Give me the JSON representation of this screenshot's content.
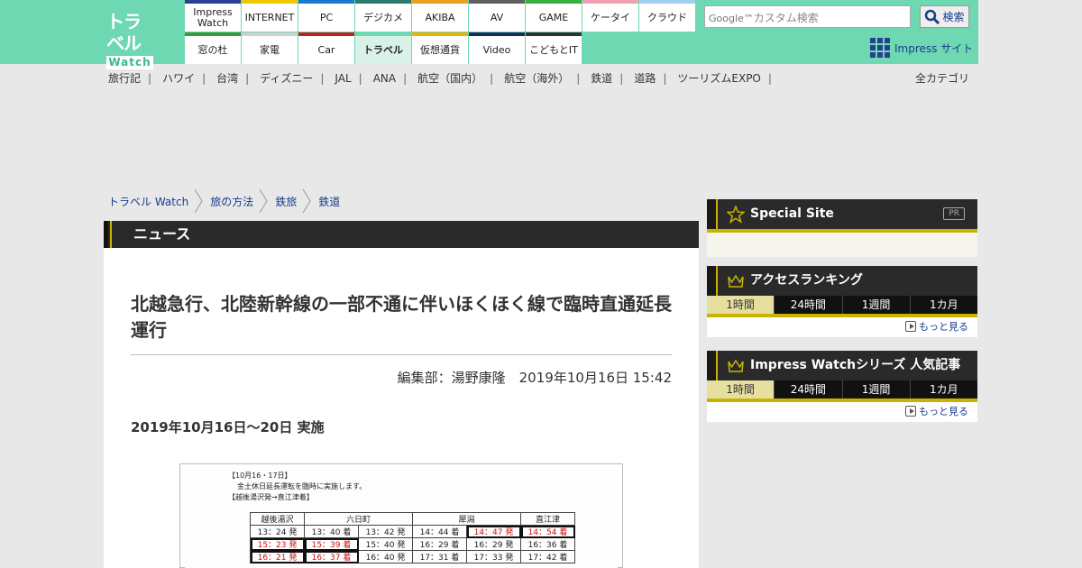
{
  "logo": {
    "top": "トラベル",
    "bottom": "Watch"
  },
  "nav_row1": [
    {
      "label": "Impress Watch",
      "color": "#2a3f90"
    },
    {
      "label": "INTERNET",
      "color": "#f0c800"
    },
    {
      "label": "PC",
      "color": "#1a7acc"
    },
    {
      "label": "デジカメ",
      "color": "#2a7a70"
    },
    {
      "label": "AKIBA",
      "color": "#e6a020"
    },
    {
      "label": "AV",
      "color": "#606060"
    },
    {
      "label": "GAME",
      "color": "#3ab040"
    },
    {
      "label": "ケータイ",
      "color": "#f0a0b0"
    },
    {
      "label": "クラウド",
      "color": "#a0d0f0"
    }
  ],
  "nav_row2": [
    {
      "label": "窓の杜",
      "color": "#3a9a3a"
    },
    {
      "label": "家電",
      "color": "#d0d0d0"
    },
    {
      "label": "Car",
      "color": "#c02020"
    },
    {
      "label": "トラベル",
      "color": "#6dd8b2"
    },
    {
      "label": "仮想通貨",
      "color": "#f0b000"
    },
    {
      "label": "Video",
      "color": "#1a2a60"
    },
    {
      "label": "こどもとIT",
      "color": "#303030"
    }
  ],
  "search": {
    "placeholder": "カスタム検索",
    "google": "Google™",
    "button": "検索"
  },
  "impress_site": "Impress サイト",
  "subnav": [
    "旅行記",
    "ハワイ",
    "台湾",
    "ディズニー",
    "JAL",
    "ANA",
    "航空（国内）",
    "航空（海外）",
    "鉄道",
    "道路",
    "ツーリズムEXPO"
  ],
  "all_categories": "全カテゴリ",
  "breadcrumb": [
    "トラベル Watch",
    "旅の方法",
    "鉄旅",
    "鉄道"
  ],
  "section_title": "ニュース",
  "article": {
    "headline": "北越急行、北陸新幹線の一部不通に伴いほくほく線で臨時直通延長運行",
    "byline": "編集部：湯野康隆　2019年10月16日 15:42",
    "subhead": "2019年10月16日～20日 実施",
    "figure": {
      "note1": "【10月16・17日】",
      "note2": "金土休日延長運転を臨時に実施します。",
      "note3": "【越後湯沢発→直江津着】",
      "headers": [
        "越後湯沢",
        "六日町",
        "",
        "犀潟",
        "",
        "直江津"
      ],
      "rows": [
        [
          "13：24 発",
          "13：40 着",
          "13：42 発",
          "14：44 着",
          "14：47 発",
          "14：54 着"
        ],
        [
          "15：23 発",
          "15：39 着",
          "15：40 発",
          "16：29 着",
          "16：29 発",
          "16：36 着"
        ],
        [
          "16：21 発",
          "16：37 着",
          "16：40 発",
          "17：31 着",
          "17：33 発",
          "17：42 着"
        ]
      ]
    }
  },
  "sidebar": {
    "special": {
      "title": "Special Site",
      "pr": "PR"
    },
    "ranking": {
      "title": "アクセスランキング",
      "tabs": [
        "1時間",
        "24時間",
        "1週間",
        "1カ月"
      ],
      "more": "もっと見る"
    },
    "popular": {
      "title": "Impress Watchシリーズ 人気記事",
      "tabs": [
        "1時間",
        "24時間",
        "1週間",
        "1カ月"
      ],
      "more": "もっと見る"
    }
  }
}
